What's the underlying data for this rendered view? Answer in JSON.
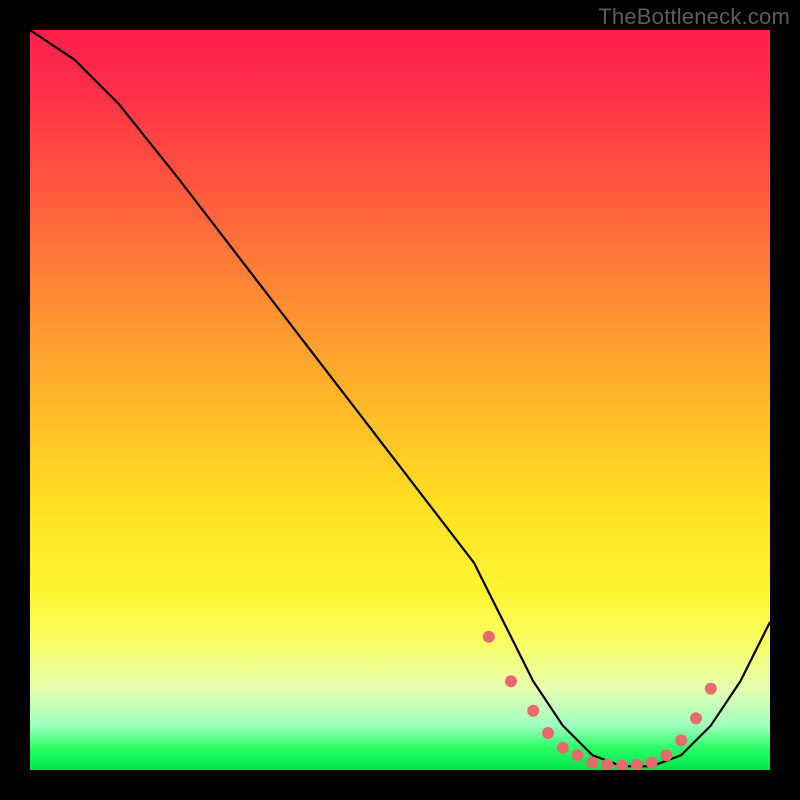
{
  "watermark": "TheBottleneck.com",
  "chart_data": {
    "type": "line",
    "title": "",
    "xlabel": "",
    "ylabel": "",
    "xlim": [
      0,
      100
    ],
    "ylim": [
      0,
      100
    ],
    "grid": false,
    "legend": false,
    "background": "red-yellow-green vertical gradient",
    "series": [
      {
        "name": "curve",
        "stroke": "#000000",
        "x": [
          0,
          6,
          12,
          20,
          30,
          40,
          50,
          60,
          64,
          68,
          72,
          76,
          80,
          84,
          88,
          92,
          96,
          100
        ],
        "y": [
          100,
          96,
          90,
          80,
          67,
          54,
          41,
          28,
          20,
          12,
          6,
          2,
          0.5,
          0.5,
          2,
          6,
          12,
          20
        ]
      }
    ],
    "markers": {
      "color": "#e76a6f",
      "radius": 6,
      "x": [
        62,
        65,
        68,
        70,
        72,
        74,
        76,
        78,
        80,
        82,
        84,
        86,
        88,
        90,
        92
      ],
      "y": [
        18,
        12,
        8,
        5,
        3,
        2,
        1,
        0.7,
        0.6,
        0.7,
        1,
        2,
        4,
        7,
        11
      ]
    }
  }
}
